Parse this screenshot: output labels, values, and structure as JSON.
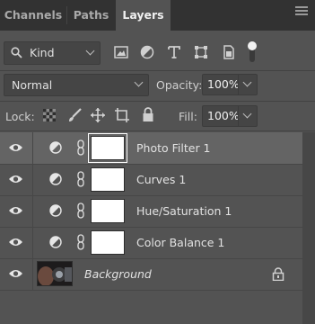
{
  "tabs": [
    {
      "label": "Channels",
      "active": false
    },
    {
      "label": "Paths",
      "active": false
    },
    {
      "label": "Layers",
      "active": true
    }
  ],
  "filter": {
    "kind_label": "Kind",
    "icons": [
      "image-filter-icon",
      "adjustment-filter-icon",
      "type-filter-icon",
      "shape-filter-icon",
      "smart-object-filter-icon",
      "filter-toggle-icon"
    ]
  },
  "blend": {
    "mode": "Normal",
    "opacity_label": "Opacity:",
    "opacity_value": "100%"
  },
  "lock": {
    "label": "Lock:",
    "fill_label": "Fill:",
    "fill_value": "100%"
  },
  "layers": [
    {
      "name": "Photo Filter 1",
      "selected": true
    },
    {
      "name": "Curves 1",
      "selected": false
    },
    {
      "name": "Hue/Saturation 1",
      "selected": false
    },
    {
      "name": "Color Balance 1",
      "selected": false
    }
  ],
  "background": {
    "name": "Background"
  }
}
